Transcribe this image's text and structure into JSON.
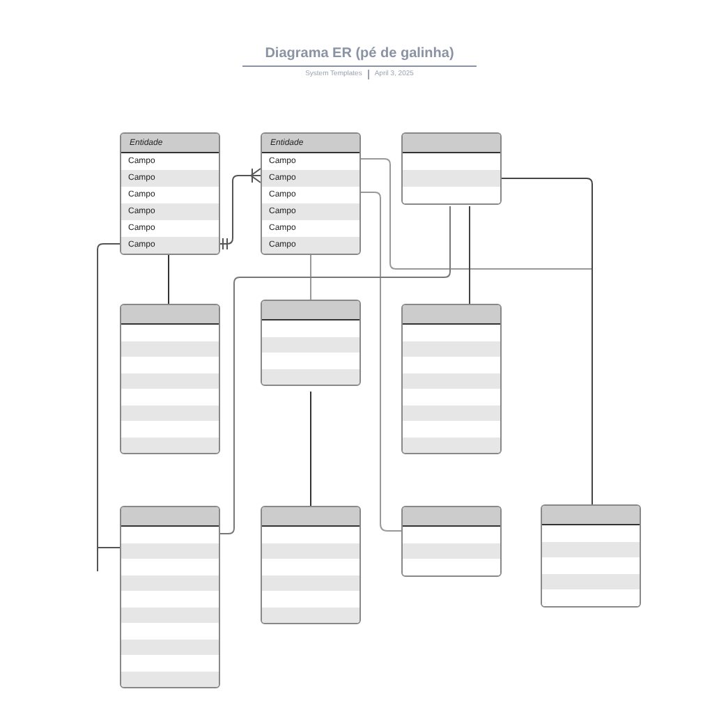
{
  "header": {
    "title": "Diagrama ER (pé de galinha)",
    "source": "System Templates",
    "date": "April 3, 2025"
  },
  "entities": [
    {
      "title": "Entidade",
      "fields": [
        {
          "kind": "text",
          "label": "Campo"
        },
        {
          "kind": "text",
          "label": "Campo"
        },
        {
          "kind": "text",
          "label": "Campo"
        },
        {
          "kind": "text",
          "label": "Campo"
        },
        {
          "kind": "text",
          "label": "Campo"
        },
        {
          "kind": "text",
          "label": "Campo"
        }
      ]
    },
    {
      "title": "Entidade",
      "fields": [
        {
          "kind": "text",
          "label": "Campo"
        },
        {
          "kind": "text",
          "label": "Campo"
        },
        {
          "kind": "text",
          "label": "Campo"
        },
        {
          "kind": "text",
          "label": "Campo"
        },
        {
          "kind": "text",
          "label": "Campo"
        },
        {
          "kind": "text",
          "label": "Campo"
        }
      ]
    },
    {
      "fields": [
        {
          "kind": "blank"
        },
        {
          "kind": "blank"
        },
        {
          "kind": "blank"
        }
      ]
    },
    {
      "fields": [
        {
          "kind": "blank"
        },
        {
          "kind": "blank"
        },
        {
          "kind": "blank"
        },
        {
          "kind": "blank"
        },
        {
          "kind": "blank"
        },
        {
          "kind": "blank"
        },
        {
          "kind": "blank"
        },
        {
          "kind": "blank"
        }
      ]
    },
    {
      "fields": [
        {
          "kind": "blank"
        },
        {
          "kind": "blank"
        },
        {
          "kind": "blank"
        },
        {
          "kind": "blank"
        }
      ]
    },
    {
      "fields": [
        {
          "kind": "blank"
        },
        {
          "kind": "blank"
        },
        {
          "kind": "blank"
        },
        {
          "kind": "blank"
        },
        {
          "kind": "blank"
        },
        {
          "kind": "blank"
        },
        {
          "kind": "blank"
        },
        {
          "kind": "blank"
        }
      ]
    },
    {
      "fields": [
        {
          "kind": "blank"
        },
        {
          "kind": "blank"
        },
        {
          "kind": "blank"
        },
        {
          "kind": "blank"
        },
        {
          "kind": "blank"
        },
        {
          "kind": "blank"
        },
        {
          "kind": "blank"
        },
        {
          "kind": "blank"
        },
        {
          "kind": "blank"
        },
        {
          "kind": "blank"
        }
      ]
    },
    {
      "fields": [
        {
          "kind": "blank"
        },
        {
          "kind": "blank"
        },
        {
          "kind": "blank"
        },
        {
          "kind": "blank"
        },
        {
          "kind": "blank"
        },
        {
          "kind": "blank"
        }
      ]
    },
    {
      "fields": [
        {
          "kind": "blank"
        },
        {
          "kind": "blank"
        },
        {
          "kind": "blank"
        }
      ]
    },
    {
      "fields": [
        {
          "kind": "blank"
        },
        {
          "kind": "blank"
        },
        {
          "kind": "blank"
        },
        {
          "kind": "blank"
        },
        {
          "kind": "blank"
        }
      ]
    }
  ]
}
